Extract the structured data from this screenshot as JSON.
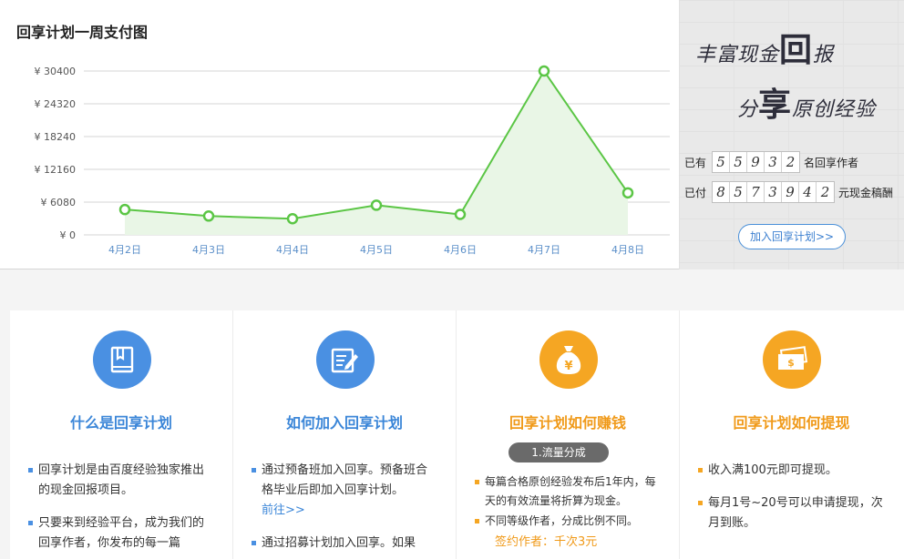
{
  "chart": {
    "title": "回享计划一周支付图"
  },
  "chart_data": {
    "type": "area",
    "title": "回享计划一周支付图",
    "categories": [
      "4月2日",
      "4月3日",
      "4月4日",
      "4月5日",
      "4月6日",
      "4月7日",
      "4月8日"
    ],
    "values": [
      4700,
      3500,
      3000,
      5500,
      3800,
      30400,
      7800
    ],
    "yticks": [
      "¥ 0",
      "¥ 6080",
      "¥ 12160",
      "¥ 18240",
      "¥ 24320",
      "¥ 30400"
    ],
    "ytick_values": [
      0,
      6080,
      12160,
      18240,
      24320,
      30400
    ],
    "ylim": [
      0,
      30400
    ],
    "grid": true,
    "colors": {
      "line": "#5bc645",
      "fill": "#e9f6e6",
      "point_fill": "#ffffff",
      "grid": "#d4d4d4",
      "xtick": "#5b8fc9",
      "ytick": "#555555"
    }
  },
  "side": {
    "slogan_line1_a": "丰富现金",
    "slogan_line1_b": "回",
    "slogan_line1_c": "报",
    "slogan_line2_a": "分",
    "slogan_line2_b": "享",
    "slogan_line2_c": "原创经验",
    "authors_prefix": "已有",
    "authors_digits": [
      "5",
      "5",
      "9",
      "3",
      "2"
    ],
    "authors_suffix": "名回享作者",
    "paid_prefix": "已付",
    "paid_digits": [
      "8",
      "5",
      "7",
      "3",
      "9",
      "4",
      "2"
    ],
    "paid_suffix": "元现金稿酬",
    "join_button": "加入回享计划>>"
  },
  "cards": [
    {
      "title": "什么是回享计划",
      "icon": "book-icon",
      "bullets": [
        "回享计划是由百度经验独家推出的现金回报项目。",
        "只要来到经验平台，成为我们的回享作者，你发布的每一篇"
      ]
    },
    {
      "title": "如何加入回享计划",
      "icon": "edit-icon",
      "bullet1": "通过预备班加入回享。预备班合格毕业后即加入回享计划。",
      "bullet1_link": "前往>>",
      "bullet2": "通过招募计划加入回享。如果"
    },
    {
      "title": "回享计划如何赚钱",
      "icon": "money-bag-icon",
      "pill": "1.流量分成",
      "bullets": [
        "每篇合格原创经验发布后1年内，每天的有效流量将折算为现金。",
        "不同等级作者，分成比例不同。"
      ],
      "gold": "签约作者：千次3元"
    },
    {
      "title": "回享计划如何提现",
      "icon": "cash-icon",
      "bullets": [
        "收入满100元即可提现。",
        "每月1号~20号可以申请提现，次月到账。"
      ]
    }
  ]
}
